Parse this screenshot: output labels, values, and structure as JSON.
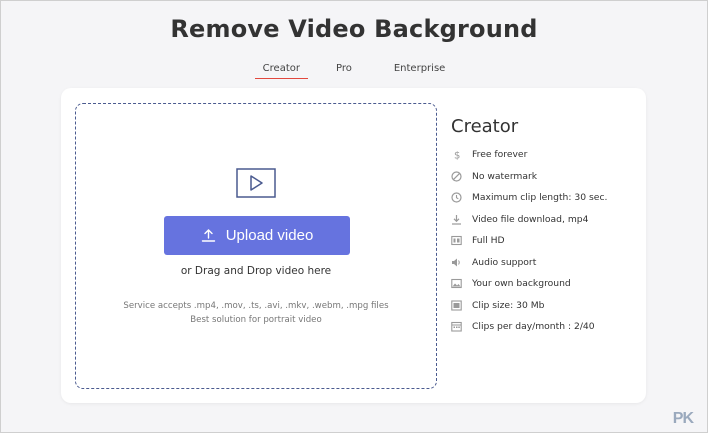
{
  "header": {
    "title": "Remove Video Background"
  },
  "tabs": [
    {
      "label": "Creator",
      "active": true
    },
    {
      "label": "Pro",
      "active": false
    },
    {
      "label": "Enterprise",
      "active": false
    }
  ],
  "upload": {
    "button_label": "Upload video",
    "drag_text": "or Drag and Drop video here",
    "accepts_line1": "Service accepts .mp4, .mov, .ts, .avi, .mkv, .webm, .mpg files",
    "accepts_line2": "Best solution for portrait video"
  },
  "plan": {
    "title": "Creator",
    "features": [
      {
        "icon": "dollar-icon",
        "label": "Free forever"
      },
      {
        "icon": "no-watermark-icon",
        "label": "No watermark"
      },
      {
        "icon": "clock-icon",
        "label": "Maximum clip length: 30 sec."
      },
      {
        "icon": "download-icon",
        "label": "Video file download, mp4"
      },
      {
        "icon": "hd-icon",
        "label": "Full HD"
      },
      {
        "icon": "audio-icon",
        "label": "Audio support"
      },
      {
        "icon": "image-icon",
        "label": "Your own background"
      },
      {
        "icon": "file-size-icon",
        "label": "Clip size: 30 Mb"
      },
      {
        "icon": "calendar-icon",
        "label": "Clips per day/month : 2/40"
      }
    ]
  },
  "colors": {
    "accent": "#6673df",
    "tab_underline": "#e2483d",
    "dashed_border": "#4a5a8f"
  },
  "watermark": "PK"
}
